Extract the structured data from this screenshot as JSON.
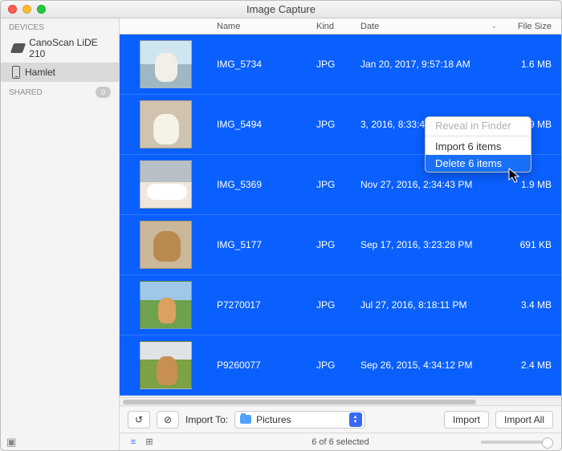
{
  "window": {
    "title": "Image Capture"
  },
  "sidebar": {
    "devices_label": "DEVICES",
    "shared_label": "SHARED",
    "shared_count": "0",
    "items": [
      {
        "label": "CanoScan LiDE 210"
      },
      {
        "label": "Hamlet"
      }
    ]
  },
  "columns": {
    "name": "Name",
    "kind": "Kind",
    "date": "Date",
    "size": "File Size"
  },
  "rows": [
    {
      "name": "IMG_5734",
      "kind": "JPG",
      "date": "Jan 20, 2017, 9:57:18 AM",
      "size": "1.6 MB"
    },
    {
      "name": "IMG_5494",
      "kind": "JPG",
      "date": "3, 2016, 8:33:41 PM",
      "size": "1.9 MB"
    },
    {
      "name": "IMG_5369",
      "kind": "JPG",
      "date": "Nov 27, 2016, 2:34:43 PM",
      "size": "1.9 MB"
    },
    {
      "name": "IMG_5177",
      "kind": "JPG",
      "date": "Sep 17, 2016, 3:23:28 PM",
      "size": "691 KB"
    },
    {
      "name": "P7270017",
      "kind": "JPG",
      "date": "Jul 27, 2016, 8:18:11 PM",
      "size": "3.4 MB"
    },
    {
      "name": "P9260077",
      "kind": "JPG",
      "date": "Sep 26, 2015, 4:34:12 PM",
      "size": "2.4 MB"
    }
  ],
  "context_menu": {
    "reveal": "Reveal in Finder",
    "import": "Import 6 items",
    "delete": "Delete 6 items"
  },
  "toolbar": {
    "rotate_glyph": "↺",
    "deny_glyph": "⊘",
    "import_to_label": "Import To:",
    "folder_name": "Pictures",
    "import_label": "Import",
    "import_all_label": "Import All"
  },
  "status": {
    "list_glyph": "≡",
    "grid_glyph": "⊞",
    "text": "6 of 6 selected",
    "expand_glyph": "▣"
  }
}
